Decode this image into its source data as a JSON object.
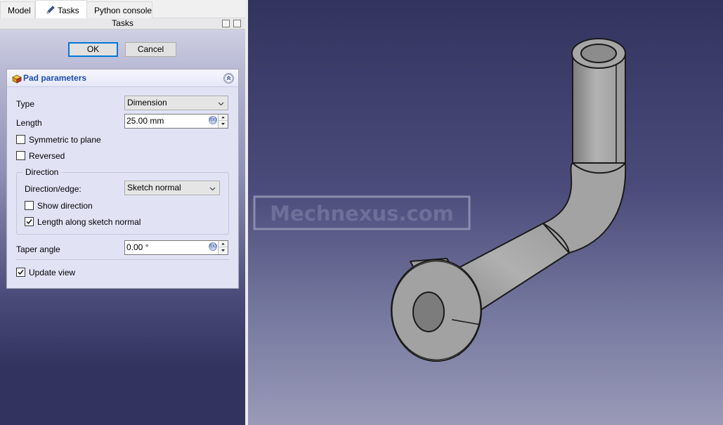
{
  "tabs": [
    {
      "label": "Model"
    },
    {
      "label": "Tasks"
    },
    {
      "label": "Python console"
    }
  ],
  "tasks_header": "Tasks",
  "buttons": {
    "ok": "OK",
    "cancel": "Cancel"
  },
  "pad": {
    "title": "Pad parameters",
    "type_label": "Type",
    "type_value": "Dimension",
    "length_label": "Length",
    "length_value": "25.00 mm",
    "symmetric_label": "Symmetric to plane",
    "symmetric_checked": false,
    "reversed_label": "Reversed",
    "reversed_checked": false,
    "direction": {
      "title": "Direction",
      "edge_label": "Direction/edge:",
      "edge_value": "Sketch normal",
      "show_direction_label": "Show direction",
      "show_direction_checked": false,
      "along_normal_label": "Length along sketch normal",
      "along_normal_checked": true
    },
    "taper_label": "Taper angle",
    "taper_value": "0.00 °",
    "update_view_label": "Update view",
    "update_view_checked": true
  },
  "viewport": {
    "watermark": "Mechnexus.com",
    "model": "bent-pipe-with-flange"
  },
  "colors": {
    "accent_blue": "#1f4db0",
    "default_button_border": "#0078d7",
    "viewport_top": "#33335f",
    "viewport_bottom": "#9a9ab8",
    "model_gray": "#a9a9a9"
  }
}
